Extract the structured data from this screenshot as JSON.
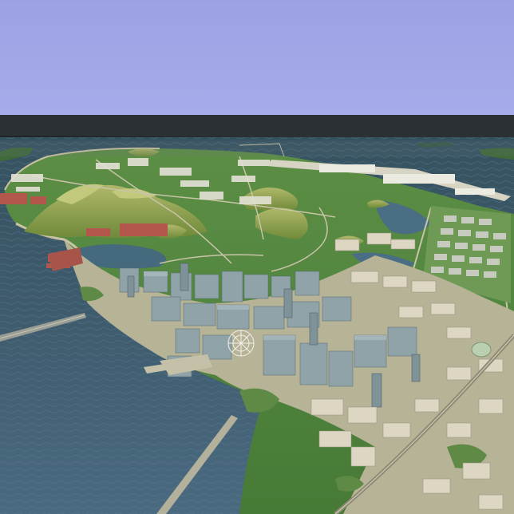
{
  "scene": {
    "colors": {
      "sky": "#9ea3e3",
      "horizon": "#2a2f33",
      "sea": "#3c5566",
      "land": "#4f8a3c",
      "hills": "#8c9a4a",
      "urban_ground": "#b8b59a",
      "buildings": "#8fa3a8",
      "low_blocks": "#ddd6c2",
      "roofs_red": "#b3564c"
    }
  }
}
